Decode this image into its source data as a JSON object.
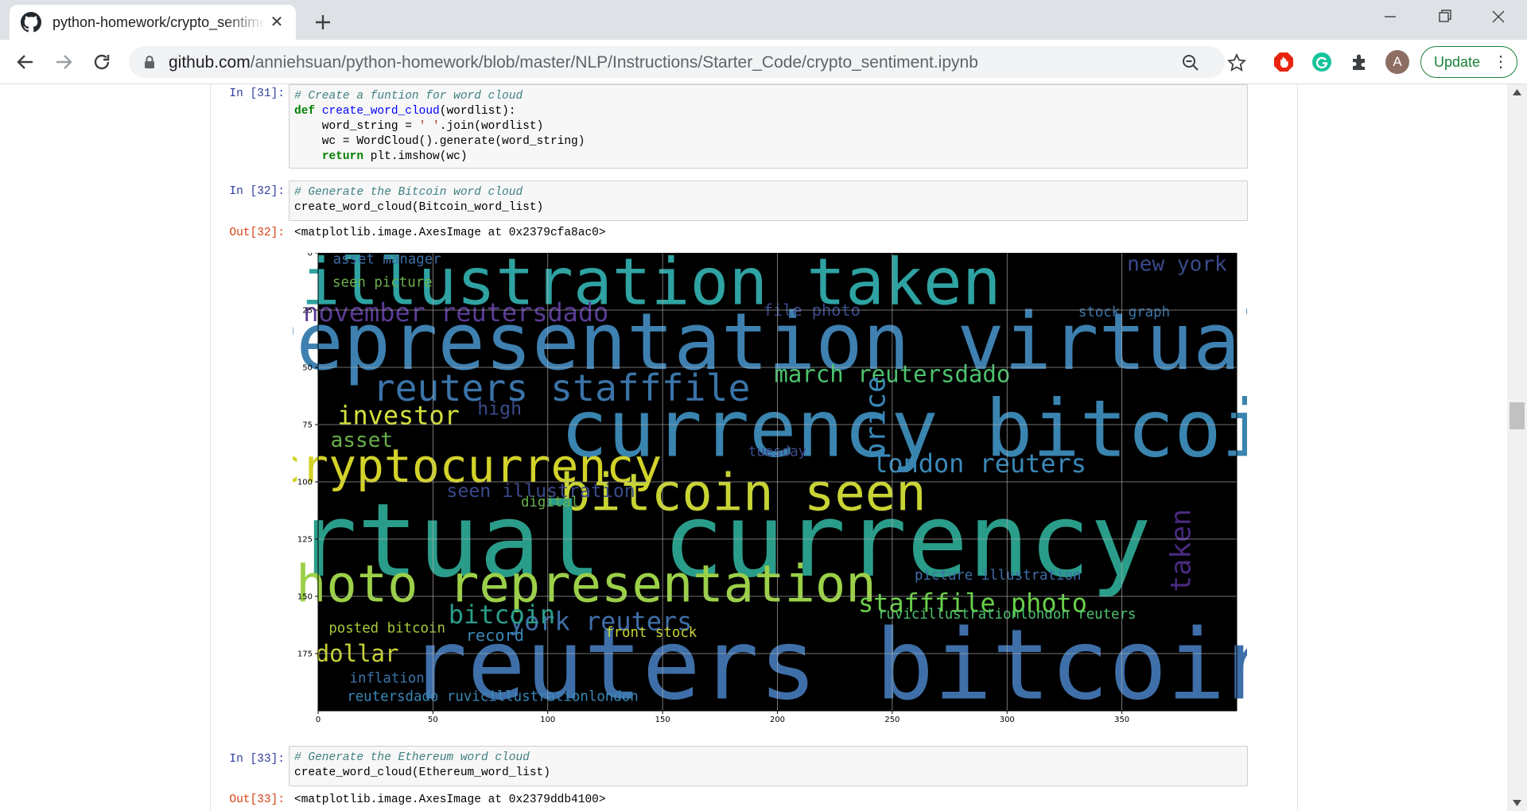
{
  "browser": {
    "tab_title": "python-homework/crypto_sentiment.ipynb",
    "tab_close": "✕",
    "url_host": "github.com",
    "url_path": "/anniehsuan/python-homework/blob/master/NLP/Instructions/Starter_Code/crypto_sentiment.ipynb",
    "avatar_letter": "A",
    "update_label": "Update",
    "icons": [
      "github-icon",
      "new-tab-icon",
      "minimize-icon",
      "restore-icon",
      "close-icon",
      "back-icon",
      "forward-icon",
      "reload-icon",
      "lock-icon",
      "zoom-out-icon",
      "star-icon",
      "adblock-icon",
      "grammarly-icon",
      "extensions-icon",
      "menu-dots-icon"
    ],
    "colors": {
      "tabstrip": "#dee1e6",
      "update_green": "#188038",
      "adblock_red": "#e8240f",
      "grammarly_green": "#15c39a"
    }
  },
  "notebook": {
    "cells": [
      {
        "prompt": "In [31]:",
        "lines": [
          "# Create a funtion for word cloud",
          "def create_word_cloud(wordlist):",
          "    word_string = ' '.join(wordlist)",
          "    wc = WordCloud().generate(word_string)",
          "    return plt.imshow(wc)"
        ]
      },
      {
        "prompt": "In [32]:",
        "lines": [
          "# Generate the Bitcoin word cloud",
          "create_word_cloud(Bitcoin_word_list)"
        ],
        "out_prompt": "Out[32]:",
        "out_text": "<matplotlib.image.AxesImage at 0x2379cfa8ac0>"
      },
      {
        "prompt": "In [33]:",
        "lines": [
          "# Generate the Ethereum word cloud",
          "create_word_cloud(Ethereum_word_list)"
        ],
        "out_prompt": "Out[33]:",
        "out_text": "<matplotlib.image.AxesImage at 0x2379ddb4100>"
      }
    ]
  },
  "chart_data": {
    "type": "heatmap",
    "image_type": "word cloud (matplotlib imshow)",
    "title": "",
    "xlabel": "",
    "ylabel": "",
    "xlim": [
      0,
      400
    ],
    "ylim": [
      200,
      0
    ],
    "xticks": [
      0,
      50,
      100,
      150,
      200,
      250,
      300,
      350
    ],
    "yticks": [
      0,
      25,
      50,
      75,
      100,
      125,
      150,
      175
    ],
    "grid": true,
    "background": "#000000",
    "words": [
      {
        "text": "illustration taken",
        "x": 145,
        "y": 13,
        "size": 28,
        "color": "#2fa2a2"
      },
      {
        "text": "representation virtual",
        "x": 196,
        "y": 39,
        "size": 34,
        "color": "#3e80b0"
      },
      {
        "text": "currency bitcoin",
        "x": 270,
        "y": 77,
        "size": 34,
        "color": "#3a84b0"
      },
      {
        "text": "cryptocurrency",
        "x": 65,
        "y": 93,
        "size": 20,
        "color": "#d2d22a"
      },
      {
        "text": "bitcoin seen",
        "x": 185,
        "y": 105,
        "size": 22,
        "color": "#c8d434"
      },
      {
        "text": "virtual currency",
        "x": 150,
        "y": 126,
        "size": 44,
        "color": "#2a9d8a"
      },
      {
        "text": "photo representation",
        "x": 110,
        "y": 145,
        "size": 22,
        "color": "#9bd048"
      },
      {
        "text": "reuters bitcoin",
        "x": 230,
        "y": 180,
        "size": 42,
        "color": "#3f6fa8"
      },
      {
        "text": "reuters stafffile",
        "x": 106,
        "y": 59,
        "size": 16,
        "color": "#3a74a8"
      },
      {
        "text": "march reutersdado",
        "x": 250,
        "y": 53,
        "size": 10,
        "color": "#4cc26e"
      },
      {
        "text": "london reuters",
        "x": 288,
        "y": 92,
        "size": 11,
        "color": "#3a88b8"
      },
      {
        "text": "november reutersdado",
        "x": 60,
        "y": 26,
        "size": 11,
        "color": "#5a3b94"
      },
      {
        "text": "investor",
        "x": 35,
        "y": 71,
        "size": 11,
        "color": "#d4e03c"
      },
      {
        "text": "asset",
        "x": 19,
        "y": 82,
        "size": 9,
        "color": "#6ab04c"
      },
      {
        "text": "dollar",
        "x": 17,
        "y": 175,
        "size": 10,
        "color": "#c8d434"
      },
      {
        "text": "price",
        "x": 243,
        "y": 72,
        "size": 12,
        "color": "#3a88b8"
      },
      {
        "text": "stafffile photo",
        "x": 285,
        "y": 153,
        "size": 11,
        "color": "#6ad04a"
      },
      {
        "text": "york reuters",
        "x": 123,
        "y": 161,
        "size": 11,
        "color": "#3f6fa8"
      },
      {
        "text": "bitcoin",
        "x": 80,
        "y": 158,
        "size": 11,
        "color": "#2a9d8a"
      },
      {
        "text": "new york",
        "x": 374,
        "y": 5,
        "size": 9,
        "color": "#3a4a8a"
      },
      {
        "text": "seen picture",
        "x": 28,
        "y": 13,
        "size": 6,
        "color": "#6ab04c"
      },
      {
        "text": "asset manager",
        "x": 30,
        "y": 3,
        "size": 6,
        "color": "#3f6fa8"
      },
      {
        "text": "seen illustration",
        "x": 97,
        "y": 104,
        "size": 8,
        "color": "#3a4a8a"
      },
      {
        "text": "picture illustration",
        "x": 296,
        "y": 141,
        "size": 6,
        "color": "#3f6fa8"
      },
      {
        "text": "posted bitcoin",
        "x": 30,
        "y": 164,
        "size": 6,
        "color": "#a8c838"
      },
      {
        "text": "record",
        "x": 77,
        "y": 167,
        "size": 7,
        "color": "#3a88b8"
      },
      {
        "text": "front stock",
        "x": 145,
        "y": 166,
        "size": 6,
        "color": "#c8d434"
      },
      {
        "text": "inflation",
        "x": 30,
        "y": 186,
        "size": 6,
        "color": "#3a74a8"
      },
      {
        "text": "reutersdado ruvicillustrationlondon",
        "x": 76,
        "y": 194,
        "size": 6,
        "color": "#3a88b8"
      },
      {
        "text": "taken",
        "x": 376,
        "y": 130,
        "size": 12,
        "color": "#4a2a80"
      },
      {
        "text": "file photo",
        "x": 215,
        "y": 25,
        "size": 7,
        "color": "#3a4a8a"
      },
      {
        "text": "stock graph",
        "x": 351,
        "y": 26,
        "size": 6,
        "color": "#3a74a8"
      },
      {
        "text": "digital",
        "x": 101,
        "y": 109,
        "size": 6,
        "color": "#6ab04c"
      },
      {
        "text": "high",
        "x": 79,
        "y": 68,
        "size": 8,
        "color": "#3a4a8a"
      },
      {
        "text": "tuesday",
        "x": 200,
        "y": 87,
        "size": 6,
        "color": "#3a4a8a"
      },
      {
        "text": "ruvicillustrationlondon reuters",
        "x": 300,
        "y": 158,
        "size": 6,
        "color": "#4cc26e"
      }
    ]
  }
}
